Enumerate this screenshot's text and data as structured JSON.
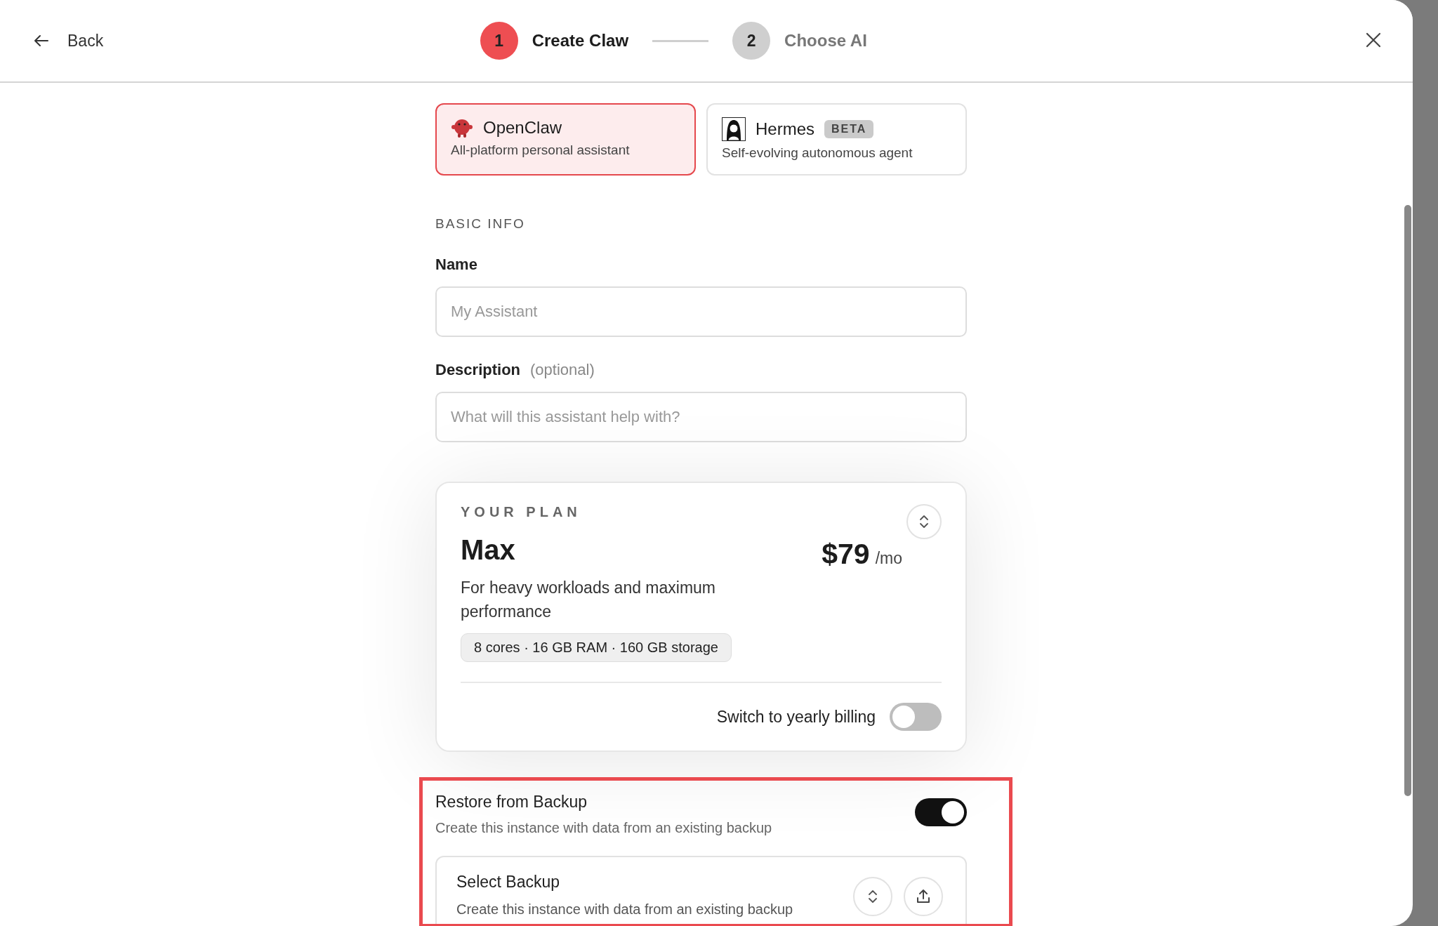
{
  "header": {
    "back": "Back",
    "steps": [
      {
        "number": "1",
        "label": "Create Claw",
        "selected": true
      },
      {
        "number": "2",
        "label": "Choose AI",
        "selected": false
      }
    ]
  },
  "instance_type": {
    "options": [
      {
        "kind": "creature",
        "name": "OpenClaw",
        "description": "All-platform personal assistant",
        "selected": true
      },
      {
        "kind": "portrait",
        "name": "Hermes",
        "badge": "BETA",
        "description": "Self-evolving autonomous agent",
        "selected": false
      }
    ]
  },
  "basic_info": {
    "heading": "BASIC INFO",
    "fields": [
      {
        "label": "Name",
        "placeholder": "My Assistant"
      },
      {
        "label": "Description",
        "hint": "(optional)",
        "placeholder": "What will this assistant help with?"
      }
    ]
  },
  "plan": {
    "heading": "YOUR PLAN",
    "name": "Max",
    "price": "$79",
    "period": "/mo",
    "description": "For heavy workloads and maximum performance",
    "specs": "8 cores · 16 GB RAM · 160 GB storage",
    "billing_toggle": {
      "label": "Switch to yearly billing",
      "on": false
    }
  },
  "restore": {
    "title": "Restore from Backup",
    "description": "Create this instance with data from an existing backup",
    "on": true,
    "highlighted": true,
    "select": {
      "title": "Select Backup",
      "description": "Create this instance with data from an existing backup"
    }
  }
}
